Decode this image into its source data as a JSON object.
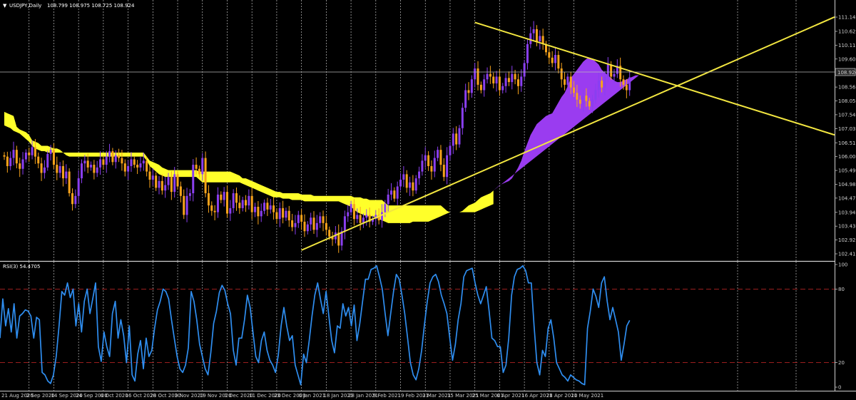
{
  "header": {
    "symbol_label": "USDJPY,Daily",
    "ohlc": "108.799 108.975 108.725 108.924"
  },
  "price_axis": {
    "ticks": [
      "111.145",
      "110.620",
      "110.110",
      "109.600",
      "109.090",
      "108.565",
      "108.055",
      "107.545",
      "107.030",
      "106.510",
      "106.000",
      "105.490",
      "104.980",
      "104.470",
      "103.945",
      "103.435",
      "102.925",
      "102.415"
    ],
    "current_price": "108.924"
  },
  "rsi": {
    "label": "RSI(3) 54.4705",
    "ticks": [
      "100",
      "80",
      "20",
      "0"
    ],
    "levels": [
      80,
      20
    ]
  },
  "date_axis": {
    "labels": [
      "21 Aug 2020",
      "2 Sep 2020",
      "14 Sep 2020",
      "24 Sep 2020",
      "6 Oct 2020",
      "16 Oct 2020",
      "28 Oct 2020",
      "9 Nov 2020",
      "19 Nov 2020",
      "1 Dec 2020",
      "11 Dec 2020",
      "23 Dec 2020",
      "6 Jan 2021",
      "18 Jan 2021",
      "28 Jan 2021",
      "9 Feb 2021",
      "19 Feb 2021",
      "3 Mar 2021",
      "15 Mar 2021",
      "25 Mar 2021",
      "6 Apr 2021",
      "16 Apr 2021",
      "28 Apr 2021",
      "10 May 2021"
    ]
  },
  "colors": {
    "background": "#000000",
    "bull_candle": "#8a3ff0",
    "bear_candle": "#f7a31b",
    "cloud_bull": "#ffff2a",
    "cloud_bear": "#9a3cf0",
    "trendline": "#f2e640",
    "rsi_line": "#2f8ef0",
    "rsi_level": "#b02222",
    "grid": "#bdbdbd"
  },
  "chart_data": [
    {
      "type": "candlestick",
      "symbol": "USDJPY",
      "timeframe": "Daily",
      "ylim": [
        102.415,
        111.145
      ],
      "close": [
        106.0,
        105.65,
        105.95,
        106.25,
        105.75,
        105.55,
        105.9,
        106.15,
        106.05,
        106.35,
        106.0,
        105.75,
        105.4,
        105.6,
        106.1,
        106.25,
        105.7,
        105.4,
        105.65,
        105.2,
        105.45,
        104.65,
        104.25,
        104.55,
        105.2,
        105.75,
        105.85,
        105.6,
        105.7,
        105.4,
        105.6,
        105.9,
        105.7,
        106.0,
        106.2,
        105.8,
        106.05,
        105.95,
        105.75,
        105.45,
        105.65,
        105.9,
        105.7,
        105.6,
        105.75,
        105.85,
        105.45,
        105.15,
        105.3,
        104.85,
        105.1,
        104.75,
        104.95,
        105.25,
        104.7,
        105.35,
        104.9,
        104.55,
        103.85,
        104.55,
        104.65,
        105.7,
        105.55,
        105.35,
        105.95,
        104.65,
        104.2,
        104.0,
        103.95,
        104.6,
        104.4,
        104.7,
        103.9,
        104.1,
        104.65,
        104.3,
        104.1,
        104.4,
        104.2,
        104.55,
        103.95,
        104.15,
        103.8,
        104.0,
        104.3,
        104.05,
        104.2,
        103.95,
        103.7,
        104.1,
        103.75,
        104.0,
        103.65,
        103.4,
        103.55,
        103.85,
        103.6,
        103.25,
        103.5,
        103.75,
        103.3,
        103.55,
        103.8,
        103.55,
        103.3,
        103.05,
        102.95,
        103.2,
        102.72,
        103.25,
        103.8,
        103.95,
        104.25,
        103.7,
        103.85,
        103.55,
        103.75,
        103.85,
        103.6,
        103.7,
        103.85,
        103.65,
        103.95,
        104.25,
        104.6,
        104.75,
        104.45,
        104.9,
        105.15,
        105.35,
        104.85,
        105.05,
        104.75,
        105.2,
        105.45,
        105.85,
        106.05,
        105.65,
        105.45,
        105.95,
        106.25,
        105.7,
        105.25,
        106.05,
        106.4,
        106.85,
        106.45,
        107.05,
        107.8,
        108.45,
        108.35,
        108.85,
        109.25,
        108.65,
        108.45,
        108.85,
        109.05,
        108.95,
        108.7,
        108.95,
        108.45,
        108.6,
        108.9,
        108.75,
        109.05,
        108.85,
        108.6,
        108.95,
        109.45,
        110.15,
        110.55,
        110.7,
        110.25,
        110.45,
        110.15,
        109.85,
        109.65,
        109.45,
        109.75,
        109.25,
        108.85,
        108.65,
        108.95,
        108.55,
        108.35,
        108.1,
        107.95,
        108.25,
        108.05,
        107.85,
        108.1,
        108.45,
        108.8,
        108.55,
        108.95,
        109.4,
        108.95,
        109.05,
        109.35,
        108.85,
        108.65,
        108.45,
        108.924
      ],
      "senkou_a": [
        107.65,
        107.6,
        107.55,
        107.5,
        107.1,
        107.0,
        106.95,
        106.9,
        106.8,
        106.6,
        106.55,
        106.5,
        106.4,
        106.4,
        106.4,
        106.35,
        106.3,
        106.3,
        106.25,
        106.15,
        106.15,
        106.15,
        106.15,
        106.15,
        106.15,
        106.15,
        106.15,
        106.15,
        106.15,
        106.15,
        106.15,
        106.15,
        106.15,
        106.15,
        106.15,
        106.15,
        106.15,
        106.15,
        106.15,
        106.15,
        106.15,
        106.15,
        106.15,
        106.15,
        106.15,
        106.15,
        106.0,
        105.85,
        105.8,
        105.75,
        105.7,
        105.6,
        105.55,
        105.5,
        105.5,
        105.5,
        105.5,
        105.5,
        105.5,
        105.5,
        105.5,
        105.5,
        105.5,
        105.45,
        105.45,
        105.45,
        105.45,
        105.45,
        105.45,
        105.45,
        105.45,
        105.45,
        105.45,
        105.45,
        105.4,
        105.35,
        105.3,
        105.2,
        105.2,
        105.15,
        105.1,
        105.05,
        105.0,
        104.95,
        104.9,
        104.85,
        104.8,
        104.75,
        104.7,
        104.7,
        104.65,
        104.65,
        104.65,
        104.65,
        104.65,
        104.65,
        104.6,
        104.6,
        104.6,
        104.6,
        104.55,
        104.55,
        104.55,
        104.55,
        104.55,
        104.55,
        104.55,
        104.55,
        104.55,
        104.55,
        104.55,
        104.55,
        104.55,
        104.5,
        104.5,
        104.5,
        104.45,
        104.45,
        104.4,
        104.4,
        104.4,
        104.4,
        104.4,
        104.3,
        104.2,
        104.2,
        104.2,
        104.2,
        104.2,
        104.2,
        104.2,
        104.2,
        104.2,
        104.2,
        104.2,
        104.2,
        104.2,
        104.2,
        104.2,
        104.2,
        104.2,
        104.2,
        104.1,
        104.0,
        103.95,
        103.95,
        103.95,
        103.95,
        104.0,
        104.1,
        104.2,
        104.25,
        104.3,
        104.4,
        104.5,
        104.55,
        104.6,
        104.65,
        104.75,
        104.85,
        104.95,
        105.0,
        105.05,
        105.1,
        105.2,
        105.4,
        105.6,
        105.85,
        106.2,
        106.5,
        106.8,
        107.0,
        107.2,
        107.3,
        107.4,
        107.5,
        107.55,
        107.6,
        107.8,
        108.0,
        108.2,
        108.35,
        108.6,
        108.9,
        109.05,
        109.2,
        109.35,
        109.5,
        109.6,
        109.65,
        109.6,
        109.5,
        109.4,
        109.2,
        109.1,
        109.0,
        108.9,
        108.8,
        108.75,
        108.75,
        108.8,
        108.85,
        108.9,
        108.95,
        109.0,
        109.0
      ],
      "senkou_b": [
        107.15,
        107.1,
        107.05,
        106.95,
        106.9,
        106.85,
        106.75,
        106.65,
        106.55,
        106.4,
        106.3,
        106.25,
        106.2,
        106.2,
        106.15,
        106.15,
        106.15,
        106.15,
        106.15,
        106.15,
        106.05,
        106.0,
        106.0,
        106.0,
        106.0,
        106.0,
        106.0,
        106.0,
        106.0,
        106.0,
        106.0,
        106.0,
        106.0,
        106.0,
        106.0,
        106.0,
        106.0,
        106.0,
        106.0,
        106.0,
        106.0,
        106.0,
        106.0,
        106.0,
        106.0,
        106.0,
        105.85,
        105.65,
        105.55,
        105.45,
        105.35,
        105.3,
        105.25,
        105.25,
        105.25,
        105.25,
        105.25,
        105.25,
        105.25,
        105.25,
        105.25,
        105.25,
        105.25,
        105.15,
        105.05,
        105.05,
        105.05,
        105.05,
        105.05,
        105.05,
        105.05,
        105.05,
        105.05,
        105.05,
        105.05,
        105.05,
        105.05,
        105.0,
        104.95,
        104.9,
        104.85,
        104.8,
        104.75,
        104.7,
        104.65,
        104.6,
        104.55,
        104.5,
        104.5,
        104.5,
        104.45,
        104.45,
        104.45,
        104.4,
        104.4,
        104.4,
        104.4,
        104.35,
        104.35,
        104.35,
        104.35,
        104.35,
        104.35,
        104.35,
        104.35,
        104.35,
        104.35,
        104.35,
        104.35,
        104.3,
        104.25,
        104.2,
        104.15,
        104.05,
        103.95,
        103.9,
        103.85,
        103.8,
        103.8,
        103.8,
        103.75,
        103.7,
        103.65,
        103.6,
        103.55,
        103.55,
        103.55,
        103.55,
        103.55,
        103.55,
        103.55,
        103.55,
        103.6,
        103.6,
        103.6,
        103.6,
        103.6,
        103.6,
        103.65,
        103.7,
        103.75,
        103.8,
        103.85,
        103.9,
        103.95,
        103.95,
        103.95,
        103.95,
        103.95,
        103.95,
        103.95,
        103.95,
        103.95,
        104.0,
        104.05,
        104.1,
        104.15,
        104.2,
        104.25,
        104.3,
        104.35,
        104.4,
        104.45,
        104.5,
        104.55,
        104.6,
        104.7,
        104.8,
        104.9,
        105.1,
        105.3,
        105.55,
        105.8,
        106.0,
        106.2,
        106.45,
        106.7,
        106.85,
        107.0,
        107.1,
        107.25,
        107.35,
        107.5,
        107.6,
        107.75,
        107.8,
        107.85,
        107.9,
        108.0,
        108.05,
        108.1,
        108.15,
        108.2,
        108.25,
        108.3,
        108.3,
        108.3,
        108.35,
        108.45,
        108.55,
        108.65,
        108.75
      ],
      "trendlines": [
        {
          "from": [
            "6 Jan 2021",
            102.55
          ],
          "to": [
            "10 May 2021+",
            111.15
          ]
        },
        {
          "from": [
            "25 Mar 2021",
            110.95
          ],
          "to": [
            "10 May 2021+",
            106.8
          ]
        }
      ]
    },
    {
      "type": "line",
      "title": "RSI(3) 54.4705",
      "ylim": [
        0,
        100
      ],
      "levels": [
        80,
        20
      ],
      "values": [
        40,
        72,
        50,
        64,
        45,
        68,
        40,
        58,
        60,
        63,
        62,
        58,
        40,
        57,
        55,
        12,
        10,
        5,
        3,
        10,
        25,
        50,
        78,
        75,
        85,
        73,
        80,
        50,
        68,
        45,
        70,
        80,
        60,
        72,
        85,
        33,
        21,
        45,
        33,
        25,
        60,
        70,
        40,
        55,
        42,
        20,
        50,
        10,
        5,
        27,
        38,
        15,
        40,
        25,
        30,
        48,
        63,
        70,
        80,
        78,
        72,
        55,
        40,
        25,
        15,
        12,
        18,
        32,
        78,
        70,
        55,
        35,
        25,
        15,
        10,
        28,
        52,
        62,
        77,
        83,
        79,
        68,
        60,
        30,
        18,
        40,
        40,
        55,
        75,
        65,
        45,
        25,
        20,
        38,
        45,
        30,
        22,
        18,
        12,
        26,
        50,
        65,
        50,
        38,
        42,
        18,
        10,
        2,
        27,
        20,
        38,
        58,
        75,
        85,
        72,
        60,
        78,
        58,
        38,
        28,
        50,
        48,
        68,
        58,
        65,
        50,
        67,
        38,
        52,
        70,
        88,
        88,
        96,
        97,
        99,
        90,
        80,
        60,
        42,
        60,
        78,
        92,
        88,
        75,
        60,
        40,
        20,
        10,
        6,
        15,
        30,
        51,
        70,
        85,
        90,
        92,
        86,
        75,
        68,
        60,
        40,
        22,
        35,
        55,
        68,
        90,
        95,
        96,
        97,
        85,
        75,
        68,
        75,
        82,
        62,
        40,
        38,
        33,
        33,
        12,
        18,
        40,
        75,
        90,
        96,
        97,
        99,
        95,
        85,
        85,
        50,
        20,
        10,
        30,
        25,
        48,
        55,
        40,
        20,
        15,
        10,
        8,
        5,
        10,
        8,
        6,
        5,
        3,
        2,
        48,
        62,
        80,
        74,
        65,
        85,
        90,
        70,
        55,
        65,
        55,
        45,
        22,
        35,
        50,
        54.47
      ],
      "xlabel": "",
      "ylabel": ""
    }
  ]
}
